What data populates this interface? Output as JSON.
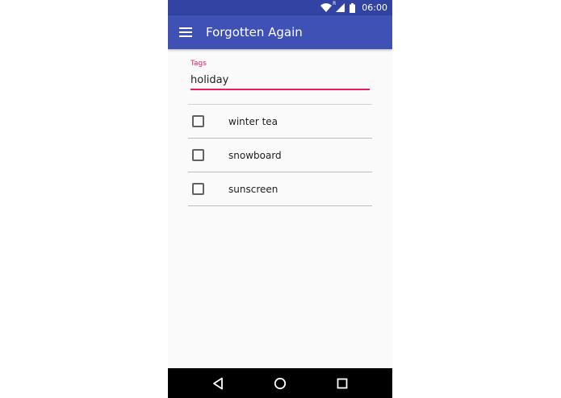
{
  "status_bar": {
    "time": "06:00",
    "network_badge": "R",
    "icons": [
      "wifi-icon",
      "signal-icon",
      "battery-icon"
    ]
  },
  "app_bar": {
    "title": "Forgotten Again",
    "menu_icon": "hamburger-menu-icon"
  },
  "tags_field": {
    "label": "Tags",
    "value": "holiday"
  },
  "items": [
    {
      "label": "winter tea",
      "checked": false
    },
    {
      "label": "snowboard",
      "checked": false
    },
    {
      "label": "sunscreen",
      "checked": false
    }
  ],
  "nav_bar": {
    "icons": [
      "back-icon",
      "home-icon",
      "recents-icon"
    ]
  },
  "colors": {
    "primary": "#3f51b5",
    "primary_dark": "#3343a3",
    "accent": "#e91e63",
    "background": "#fafafa",
    "nav_bar": "#000000"
  }
}
